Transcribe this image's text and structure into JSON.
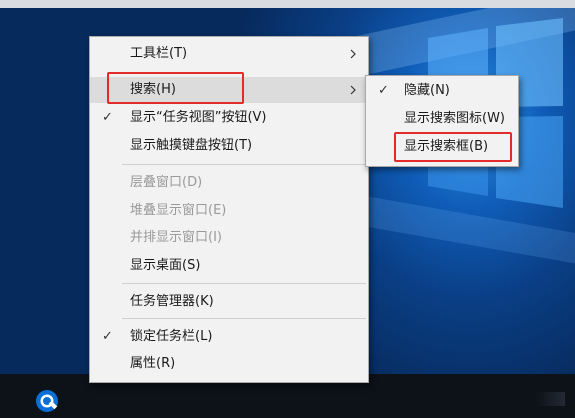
{
  "context_menu": {
    "items": [
      {
        "label": "工具栏(T)",
        "has_submenu": true
      },
      {
        "label": "搜索(H)",
        "has_submenu": true,
        "highlighted": true
      },
      {
        "label": "显示“任务视图”按钮(V)",
        "checked": true
      },
      {
        "label": "显示触摸键盘按钮(T)"
      },
      {
        "label": "层叠窗口(D)",
        "disabled": true
      },
      {
        "label": "堆叠显示窗口(E)",
        "disabled": true
      },
      {
        "label": "并排显示窗口(I)",
        "disabled": true
      },
      {
        "label": "显示桌面(S)"
      },
      {
        "label": "任务管理器(K)"
      },
      {
        "label": "锁定任务栏(L)",
        "checked": true
      },
      {
        "label": "属性(R)"
      }
    ]
  },
  "search_submenu": {
    "items": [
      {
        "label": "隐藏(N)",
        "checked": true
      },
      {
        "label": "显示搜索图标(W)"
      },
      {
        "label": "显示搜索框(B)",
        "annotated": true
      }
    ]
  },
  "icons": {
    "check": "checkmark-icon",
    "arrow": "chevron-right-icon",
    "taskbar": "cortana-search-icon",
    "wallpaper": "windows-logo-icon"
  },
  "colors": {
    "annotation": "#e32b2b",
    "menu_bg": "#f2f2f2",
    "hover_bg": "#dcdcdc",
    "disabled_text": "#9a9a9a",
    "taskbar": "#0d1118"
  }
}
